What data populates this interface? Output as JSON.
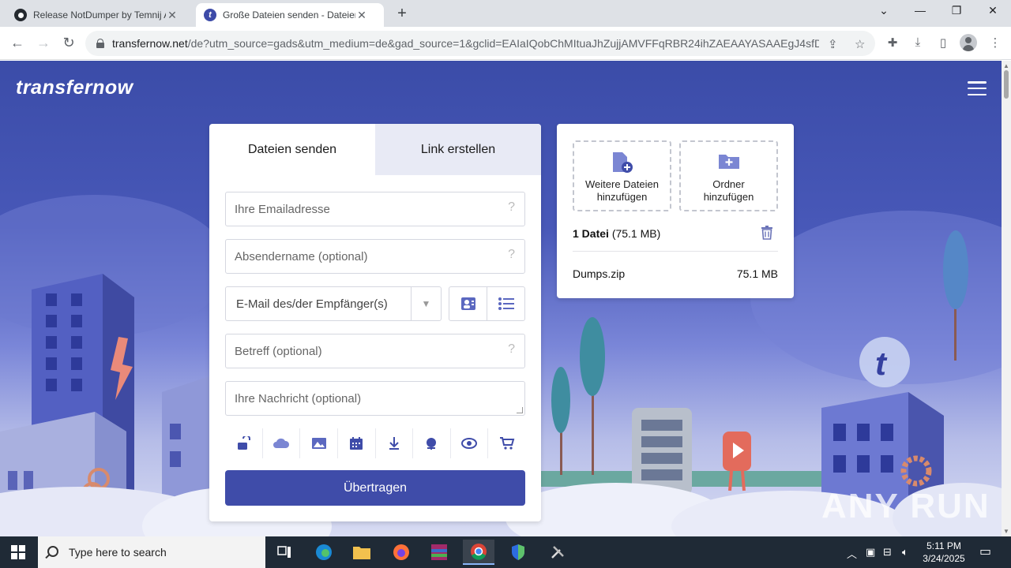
{
  "browser": {
    "tabs": [
      {
        "title": "Release NotDumper by Temnij A",
        "active": false
      },
      {
        "title": "Große Dateien senden - Dateien",
        "active": true
      }
    ],
    "url_host": "transfernow.net",
    "url_path": "/de?utm_source=gads&utm_medium=de&gad_source=1&gclid=EAIaIQobChMItuaJhZujjAMVFFqRBR24ihZAEAAYASAAEgJ4sfD_..."
  },
  "page": {
    "logo": "transfernow",
    "form": {
      "tabs": [
        "Dateien senden",
        "Link erstellen"
      ],
      "email_placeholder": "Ihre Emailadresse",
      "sender_placeholder": "Absendername (optional)",
      "recipient_placeholder": "E-Mail des/der Empfänger(s)",
      "subject_placeholder": "Betreff (optional)",
      "message_placeholder": "Ihre Nachricht (optional)",
      "help_mark": "?",
      "submit_label": "Übertragen"
    },
    "files": {
      "add_files_label": "Weitere Dateien hinzufügen",
      "add_folder_label": "Ordner hinzufügen",
      "summary_count": "1 Datei",
      "summary_size": "(75.1 MB)",
      "items": [
        {
          "name": "Dumps.zip",
          "size": "75.1 MB"
        }
      ]
    },
    "watermark": "ANY RUN"
  },
  "taskbar": {
    "search_placeholder": "Type here to search",
    "time": "5:11 PM",
    "date": "3/24/2025"
  },
  "colors": {
    "brand": "#3f4ca9",
    "page_bg_top": "#3b4ca8",
    "taskbar": "#1f2a36"
  }
}
